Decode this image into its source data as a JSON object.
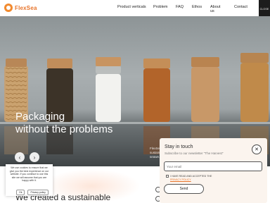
{
  "header": {
    "logo_text": "FlexSea",
    "nav": [
      "Product verticals",
      "Problem",
      "FAQ",
      "Ethos",
      "About us",
      "Contact"
    ],
    "close_label": "CLOSE"
  },
  "hero": {
    "title_line1": "Packaging",
    "title_line2": "without the problems",
    "side_text": "FlexSe... sustain... seawe..."
  },
  "section": {
    "title": "We created a sustainable"
  },
  "cookie": {
    "text": "We use cookies to ensure that we give you the best experience on our website. If you continue to use this site we will assume that you are happy with it.",
    "ok_label": "Ok",
    "policy_label": "Privacy policy"
  },
  "newsletter": {
    "title": "Stay in touch",
    "subtitle": "Subscribe to our newsletter \"The Harvest\"",
    "email_placeholder": "Your email",
    "consent_text": "I HAVE READ AND ACCEPTED THE",
    "consent_link": "PRIVACY POLICY",
    "send_label": "Send"
  },
  "icons": {
    "logo": "flexsea-logo-icon",
    "prev": "arrow-left-icon",
    "next": "arrow-right-icon",
    "close": "close-icon"
  },
  "colors": {
    "brand": "#e8742a",
    "popup_bg": "#fbf4ee",
    "close_tab": "#1c1c1c"
  }
}
